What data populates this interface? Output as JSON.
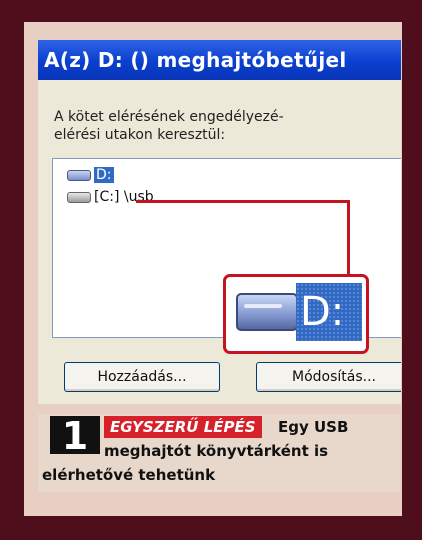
{
  "dialog": {
    "title": "A(z) D: () meghajtóbetűjel",
    "instructions_line1": "A kötet elérésének engedélyezé-",
    "instructions_line2": "elérési utakon keresztül:",
    "paths": [
      {
        "label": "D:",
        "selected": true,
        "icon": "usb-drive-icon"
      },
      {
        "label": "[C:] \\usb",
        "selected": false,
        "icon": "hard-drive-icon"
      }
    ],
    "zoom_label": "D:",
    "add_button": "Hozzáadás...",
    "modify_button": "Módosítás..."
  },
  "caption": {
    "number": "1",
    "tag": "EGYSZERŰ LÉPÉS",
    "text_line1": "Egy USB",
    "text_line2": "meghajtót könyvtárként is",
    "text_line3": "elérhetővé tehetünk"
  },
  "colors": {
    "frame": "#4e0e1c",
    "accent_red": "#c4141f",
    "selection_blue": "#316ac5",
    "titlebar_blue": "#0a3fd0"
  }
}
